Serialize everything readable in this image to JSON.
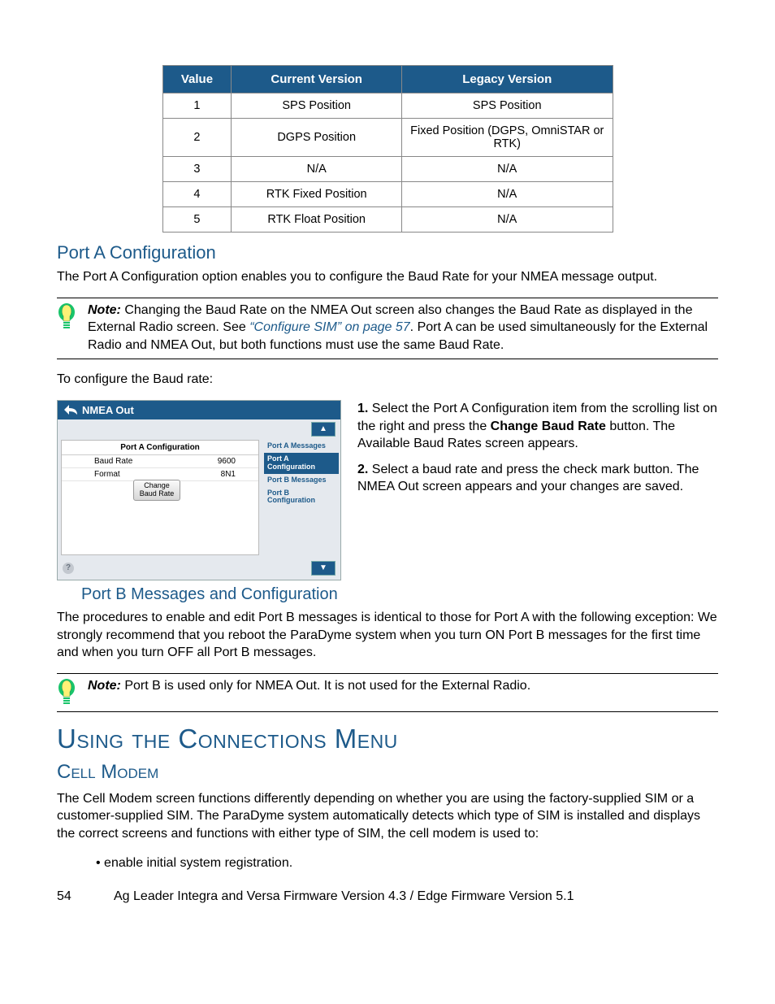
{
  "table": {
    "headers": [
      "Value",
      "Current Version",
      "Legacy Version"
    ],
    "rows": [
      {
        "value": "1",
        "current": "SPS Position",
        "legacy": "SPS Position"
      },
      {
        "value": "2",
        "current": "DGPS Position",
        "legacy": "Fixed Position (DGPS, OmniSTAR or RTK)"
      },
      {
        "value": "3",
        "current": "N/A",
        "legacy": "N/A"
      },
      {
        "value": "4",
        "current": "RTK Fixed Position",
        "legacy": "N/A"
      },
      {
        "value": "5",
        "current": "RTK Float Position",
        "legacy": "N/A"
      }
    ]
  },
  "portA": {
    "heading": "Port A Configuration",
    "body": "The Port A Configuration option enables you to configure the Baud Rate for your NMEA message output.",
    "note_label": "Note:",
    "note_a": "Changing the Baud Rate on the NMEA Out screen also changes the Baud Rate as displayed in the External Radio screen. See ",
    "note_link": "“Configure SIM” on page 57",
    "note_b": ". Port A can be used simultaneously for the External Radio and NMEA Out, but both functions must use the same Baud Rate.",
    "lead": "To configure the Baud rate:"
  },
  "figure": {
    "title": "NMEA Out",
    "panel_header": "Port A Configuration",
    "row1_label": "Baud Rate",
    "row1_val": "9600",
    "row2_label": "Format",
    "row2_val": "8N1",
    "button": "Change Baud Rate",
    "side_items": [
      "Port A Messages",
      "Port A Configuration",
      "Port B Messages",
      "Port B Configuration"
    ],
    "side_selected_index": 1
  },
  "steps": {
    "s1_num": "1.",
    "s1a": "Select the Port A Configuration item from the scrolling list on the right and press the ",
    "s1_bold": "Change Baud Rate",
    "s1b": " button. The Available Baud Rates screen appears.",
    "s2_num": "2.",
    "s2": "Select a baud rate and press the check mark button. The NMEA Out screen appears and your changes are saved."
  },
  "portB": {
    "heading": "Port B Messages and Configuration",
    "body": "The procedures to enable and edit Port B messages is identical to those for Port A with the following exception: We strongly recommend that you reboot the ParaDyme system when you turn ON Port B messages for the first time and when you turn OFF all Port B messages.",
    "note_label": "Note:",
    "note": "Port B is used only for NMEA Out. It is not used for the External Radio."
  },
  "connections": {
    "heading": "Using the Connections Menu",
    "cell_heading": "Cell Modem",
    "cell_body": "The Cell Modem screen functions differently depending on whether you are using the factory-supplied SIM or a customer-supplied SIM. The ParaDyme system automatically detects which type of SIM is installed and displays the correct screens and functions with either type of SIM, the cell modem is used to:",
    "bullet1": "enable initial system registration."
  },
  "footer": {
    "page": "54",
    "text": "Ag Leader Integra and Versa Firmware Version 4.3  /  Edge Firmware Version 5.1"
  }
}
